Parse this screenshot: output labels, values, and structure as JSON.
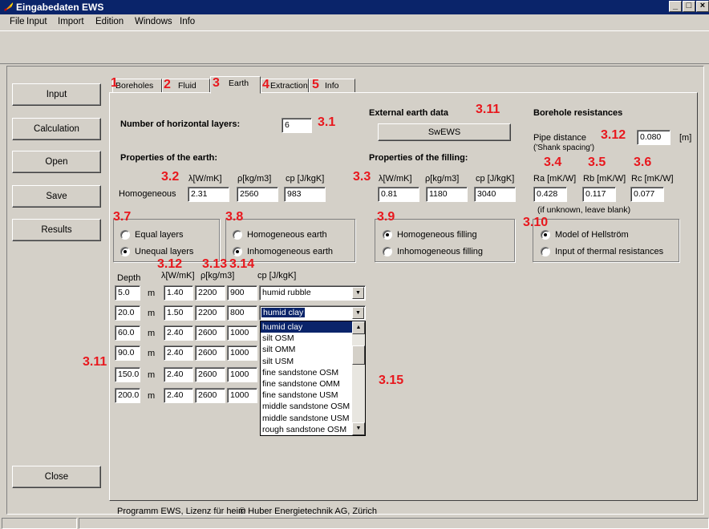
{
  "window": {
    "title": "Eingabedaten EWS",
    "min": "_",
    "max": "□",
    "close": "×"
  },
  "menu": [
    "File",
    "Input",
    "Import",
    "Edition",
    "Windows",
    "Info"
  ],
  "nav": [
    "Input",
    "Calculation",
    "Open",
    "Save",
    "Results",
    "Close"
  ],
  "tabs": [
    {
      "num": "1",
      "label": "Boreholes"
    },
    {
      "num": "2",
      "label": "Fluid"
    },
    {
      "num": "3",
      "label": "Earth"
    },
    {
      "num": "4",
      "label": "Extraction"
    },
    {
      "num": "5",
      "label": "Info"
    }
  ],
  "earth": {
    "layers_label": "Number of horizontal layers:",
    "layers_value": "6",
    "layers_marker": "3.1",
    "props_title": "Properties of the earth:",
    "props_marker": "3.2",
    "lambda_h": "λ[W/mK]",
    "rho_h": "ρ[kg/m3]",
    "cp_h": "cp [J/kgK]",
    "homog_label": "Homogeneous",
    "lambda": "2.31",
    "rho": "2560",
    "cp": "983"
  },
  "external": {
    "title": "External earth data",
    "marker": "3.11",
    "button": "SwEWS"
  },
  "filling": {
    "title": "Properties of the filling:",
    "marker": "3.3",
    "lambda_h": "λ[W/mK]",
    "rho_h": "ρ[kg/m3]",
    "cp_h": "cp [J/kgK]",
    "lambda": "0.81",
    "rho": "1180",
    "cp": "3040"
  },
  "resist": {
    "title": "Borehole resistances",
    "pipe_label": "Pipe distance",
    "pipe_sub": "('Shank spacing')",
    "pipe_marker": "3.12",
    "pipe_value": "0.080",
    "pipe_unit": "[m]",
    "ra_marker": "3.4",
    "rb_marker": "3.5",
    "rc_marker": "3.6",
    "ra_h": "Ra [mK/W]",
    "rb_h": "Rb [mK/W]",
    "rc_h": "Rc [mK/W]",
    "ra": "0.428",
    "rb": "0.117",
    "rc": "0.077",
    "note": "(if unknown, leave blank)"
  },
  "group37": {
    "marker": "3.7",
    "opt1": "Equal layers",
    "opt2": "Unequal layers"
  },
  "group38": {
    "marker": "3.8",
    "opt1": "Homogeneous earth",
    "opt2": "Inhomogeneous earth"
  },
  "group39": {
    "marker": "3.9",
    "opt1": "Homogeneous filling",
    "opt2": "Inhomogeneous filling"
  },
  "group310": {
    "marker": "3.10",
    "opt1": "Model of Hellström",
    "opt2": "Input of thermal resistances"
  },
  "layers": {
    "m312": "3.12",
    "m313": "3.13",
    "m314": "3.14",
    "m311": "3.11",
    "m315": "3.15",
    "depth_h": "Depth",
    "lambda_h": "λ[W/mK]",
    "rho_h": "ρ[kg/m3]",
    "cp_h": "cp [J/kgK]",
    "unit": "m",
    "rows": [
      {
        "depth": "5.0",
        "lambda": "1.40",
        "rho": "2200",
        "cp": "900",
        "material": "humid rubble"
      },
      {
        "depth": "20.0",
        "lambda": "1.50",
        "rho": "2200",
        "cp": "800",
        "material": "humid clay"
      },
      {
        "depth": "60.0",
        "lambda": "2.40",
        "rho": "2600",
        "cp": "1000"
      },
      {
        "depth": "90.0",
        "lambda": "2.40",
        "rho": "2600",
        "cp": "1000"
      },
      {
        "depth": "150.0",
        "lambda": "2.40",
        "rho": "2600",
        "cp": "1000"
      },
      {
        "depth": "200.0",
        "lambda": "2.40",
        "rho": "2600",
        "cp": "1000"
      }
    ],
    "dropdown": [
      "humid clay",
      "silt OSM",
      "silt OMM",
      "silt USM",
      "fine sandstone OSM",
      "fine sandstone OMM",
      "fine sandstone USM",
      "middle sandstone OSM",
      "middle sandstone USM",
      "rough sandstone OSM"
    ]
  },
  "footer": {
    "license": "Programm EWS, Lizenz für heim",
    "copyright": "© Huber Energietechnik AG, Zürich"
  },
  "colors": {
    "accent": "#e8171d",
    "titlebar": "#0a246a",
    "face": "#d4d0c8"
  }
}
